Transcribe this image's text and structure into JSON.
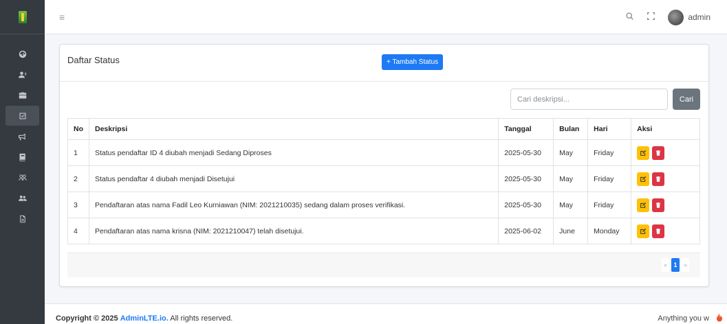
{
  "navbar": {
    "menu_icon": "bars-icon",
    "user_name": "admin"
  },
  "sidebar": {
    "items": [
      {
        "icon": "dashboard-icon"
      },
      {
        "icon": "users-icon"
      },
      {
        "icon": "briefcase-icon"
      },
      {
        "icon": "check-square-icon",
        "active": true
      },
      {
        "icon": "bullhorn-icon"
      },
      {
        "icon": "book-icon"
      },
      {
        "icon": "user-group-icon"
      },
      {
        "icon": "user-friends-icon"
      },
      {
        "icon": "file-icon"
      }
    ]
  },
  "card": {
    "title": "Daftar Status",
    "add_button_label": "+ Tambah Status",
    "search": {
      "placeholder": "Cari deskripsi...",
      "button_label": "Cari"
    },
    "table": {
      "headers": [
        "No",
        "Deskripsi",
        "Tanggal",
        "Bulan",
        "Hari",
        "Aksi"
      ],
      "rows": [
        [
          "1",
          "Status pendaftar ID 4 diubah menjadi Sedang Diproses",
          "2025-05-30",
          "May",
          "Friday"
        ],
        [
          "2",
          "Status pendaftar 4 diubah menjadi Disetujui",
          "2025-05-30",
          "May",
          "Friday"
        ],
        [
          "3",
          "Pendaftaran atas nama Fadil Leo Kurniawan (NIM: 2021210035) sedang dalam proses verifikasi.",
          "2025-05-30",
          "May",
          "Friday"
        ],
        [
          "4",
          "Pendaftaran atas nama krisna (NIM: 2021210047) telah disetujui.",
          "2025-06-02",
          "June",
          "Monday"
        ]
      ]
    },
    "pagination": {
      "prev": "«",
      "current": "1",
      "next": "»"
    }
  },
  "footer": {
    "copyright_prefix": "Copyright © 2025",
    "brand": "AdminLTE.io.",
    "rights": "All rights reserved.",
    "right_text": "Anything you w"
  },
  "colors": {
    "primary": "#1e7af4",
    "warning": "#ffc107",
    "danger": "#dc3545",
    "secondary": "#6c757d",
    "sidebar": "#343a40"
  }
}
